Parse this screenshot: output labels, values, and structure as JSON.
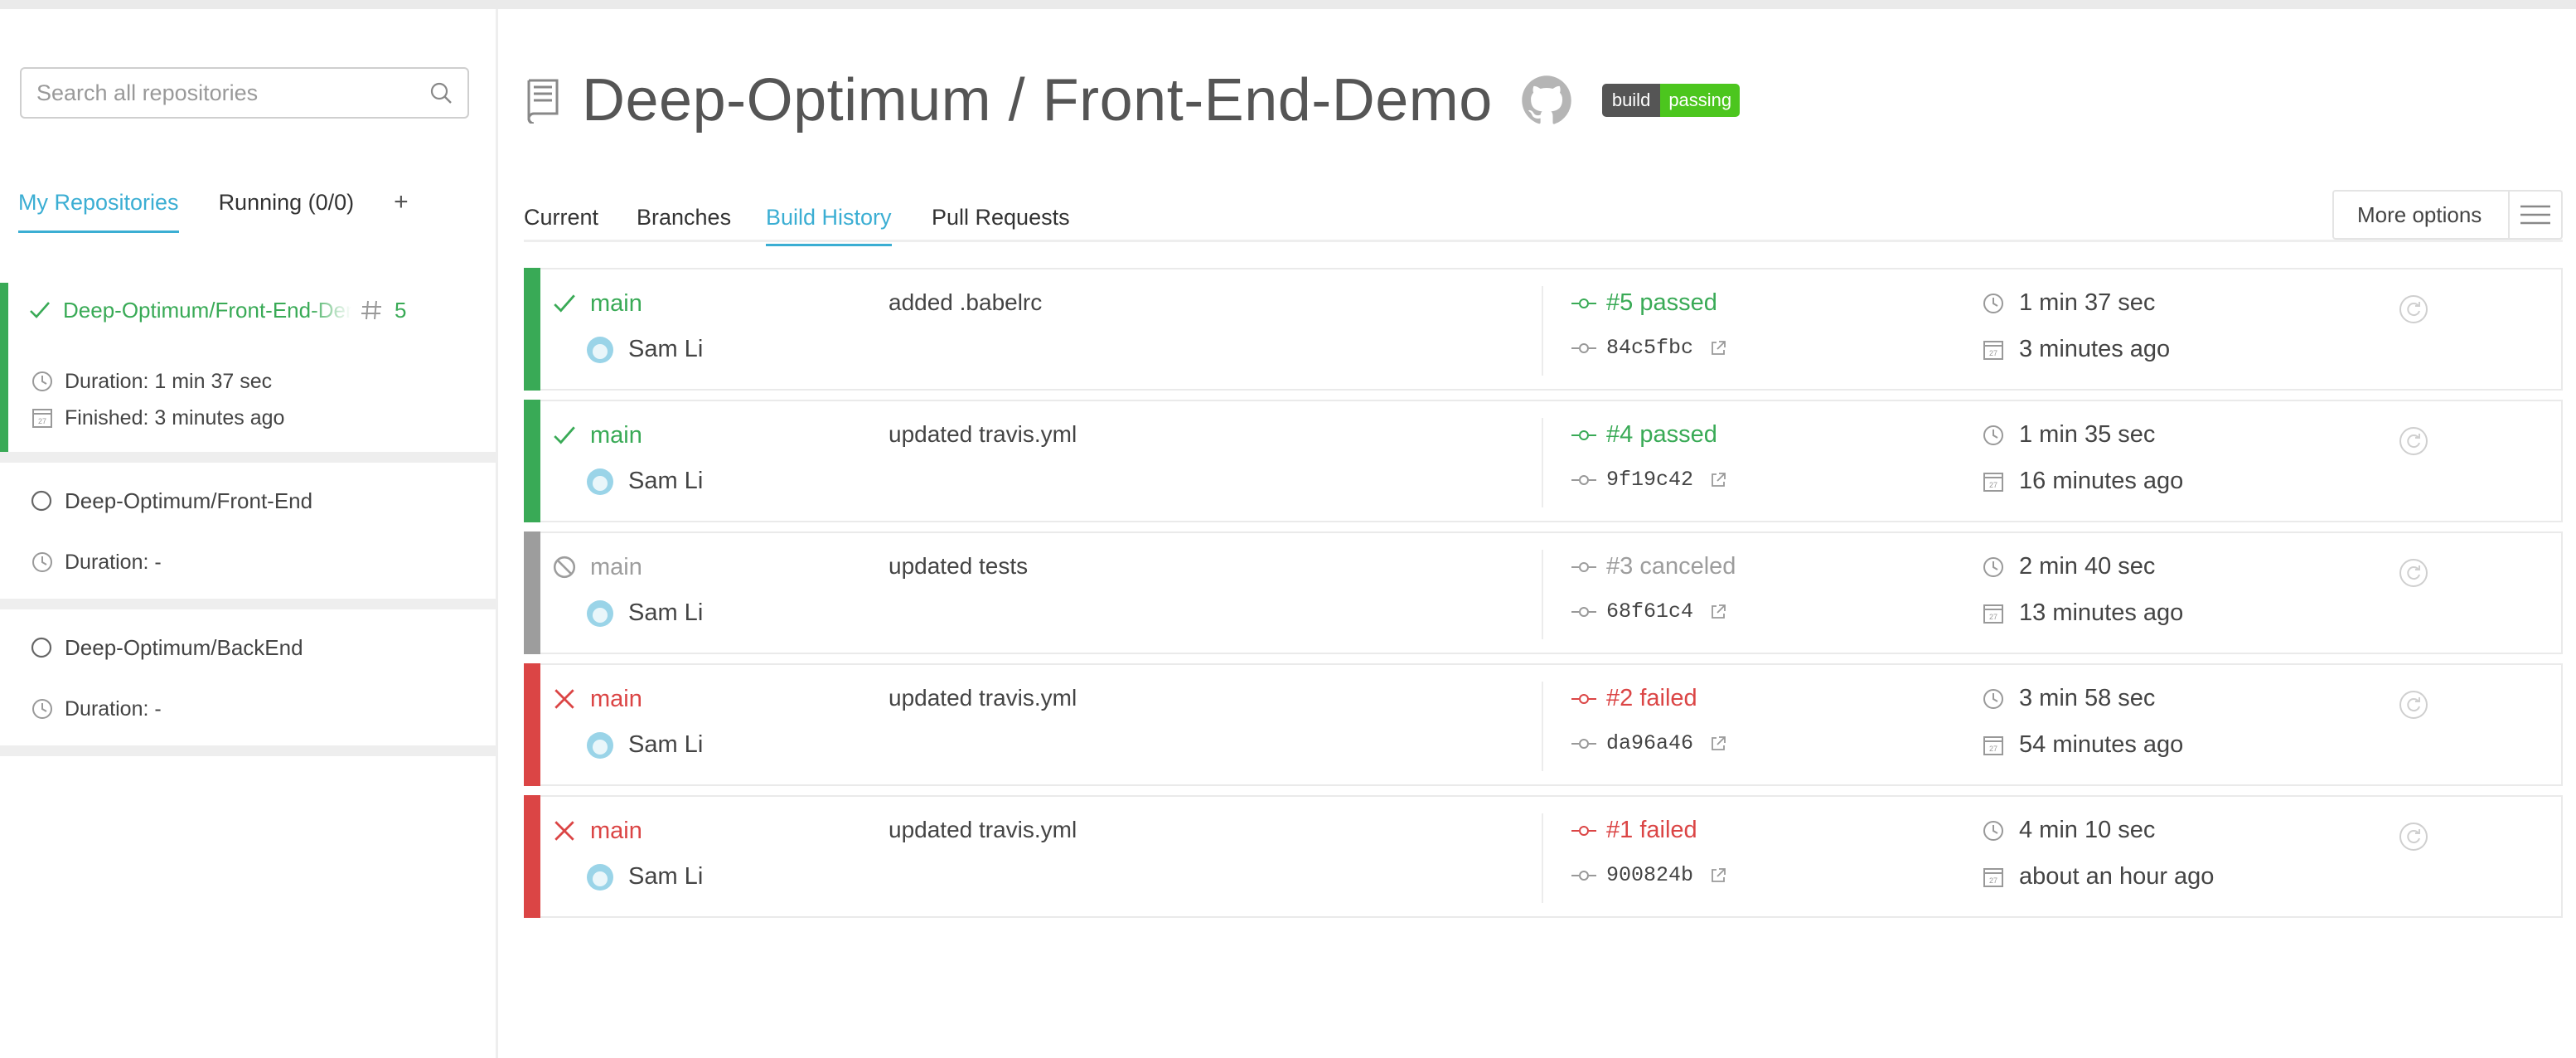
{
  "colors": {
    "passed": "#39aa56",
    "failed": "#db4545",
    "canceled": "#9d9d9d",
    "accent": "#3baed3",
    "badge_label": "#555555",
    "badge_value": "#4cc61e"
  },
  "sidebar": {
    "search_placeholder": "Search all repositories",
    "tabs": [
      {
        "label": "My Repositories",
        "active": true
      },
      {
        "label": "Running (0/0)",
        "active": false
      },
      {
        "label": "+",
        "active": false
      }
    ],
    "repos": [
      {
        "name": "Deep-Optimum/Front-End-Demo",
        "build_number": "5",
        "status": "passed",
        "duration": "Duration: 1 min 37 sec",
        "finished": "Finished: 3 minutes ago"
      },
      {
        "name": "Deep-Optimum/Front-End",
        "status": "none",
        "duration": "Duration: -"
      },
      {
        "name": "Deep-Optimum/BackEnd",
        "status": "none",
        "duration": "Duration: -"
      }
    ]
  },
  "header": {
    "title": "Deep-Optimum / Front-End-Demo",
    "badge_label": "build",
    "badge_value": "passing"
  },
  "tabs": [
    {
      "label": "Current",
      "active": false
    },
    {
      "label": "Branches",
      "active": false
    },
    {
      "label": "Build History",
      "active": true
    },
    {
      "label": "Pull Requests",
      "active": false
    }
  ],
  "more_options": "More options",
  "builds": [
    {
      "status": "passed",
      "branch": "main",
      "author": "Sam Li",
      "message": "added .babelrc",
      "number": "#5 passed",
      "sha": "84c5fbc",
      "duration": "1 min 37 sec",
      "ago": "3 minutes ago"
    },
    {
      "status": "passed",
      "branch": "main",
      "author": "Sam Li",
      "message": "updated travis.yml",
      "number": "#4 passed",
      "sha": "9f19c42",
      "duration": "1 min 35 sec",
      "ago": "16 minutes ago"
    },
    {
      "status": "canceled",
      "branch": "main",
      "author": "Sam Li",
      "message": "updated tests",
      "number": "#3 canceled",
      "sha": "68f61c4",
      "duration": "2 min 40 sec",
      "ago": "13 minutes ago"
    },
    {
      "status": "failed",
      "branch": "main",
      "author": "Sam Li",
      "message": "updated travis.yml",
      "number": "#2 failed",
      "sha": "da96a46",
      "duration": "3 min 58 sec",
      "ago": "54 minutes ago"
    },
    {
      "status": "failed",
      "branch": "main",
      "author": "Sam Li",
      "message": "updated travis.yml",
      "number": "#1 failed",
      "sha": "900824b",
      "duration": "4 min 10 sec",
      "ago": "about an hour ago"
    }
  ]
}
